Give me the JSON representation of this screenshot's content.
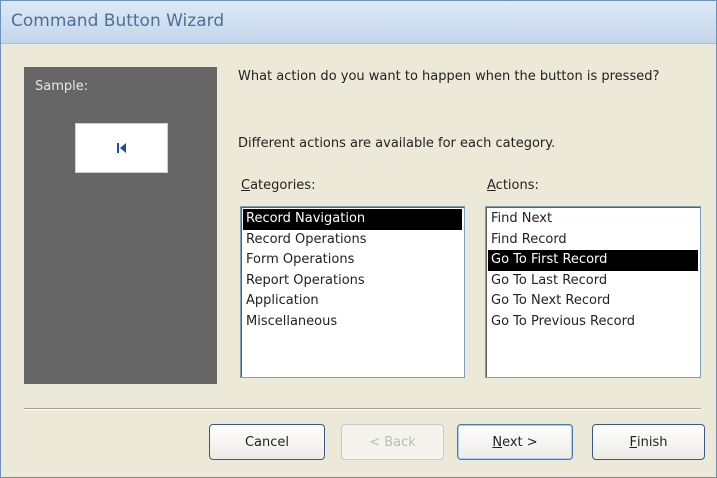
{
  "window": {
    "title": "Command Button Wizard"
  },
  "sample": {
    "label": "Sample:"
  },
  "prompt": {
    "question": "What action do you want to happen when the button is pressed?",
    "subtext": "Different actions are available for each category."
  },
  "categories": {
    "label_accel": "C",
    "label_rest": "ategories:",
    "items": [
      {
        "label": "Record Navigation",
        "selected": true
      },
      {
        "label": "Record Operations"
      },
      {
        "label": "Form Operations"
      },
      {
        "label": "Report Operations"
      },
      {
        "label": "Application"
      },
      {
        "label": "Miscellaneous"
      }
    ]
  },
  "actions": {
    "label_accel": "A",
    "label_rest": "ctions:",
    "items": [
      {
        "label": "Find Next"
      },
      {
        "label": "Find Record"
      },
      {
        "label": "Go To First Record",
        "selected": true
      },
      {
        "label": "Go To Last Record"
      },
      {
        "label": "Go To Next Record"
      },
      {
        "label": "Go To Previous Record"
      }
    ]
  },
  "buttons": {
    "cancel": "Cancel",
    "back": "< Back",
    "next_accel": "N",
    "next_rest": "ext >",
    "finish_accel": "F",
    "finish_rest": "inish"
  },
  "colors": {
    "selection": "#000000",
    "sample_pane": "#666666",
    "dialog_bg": "#ece9d8",
    "title_text": "#4d6f98",
    "first_record_icon": "#1f4aa8"
  },
  "icons": {
    "sample_button_icon": "first-record-icon"
  }
}
